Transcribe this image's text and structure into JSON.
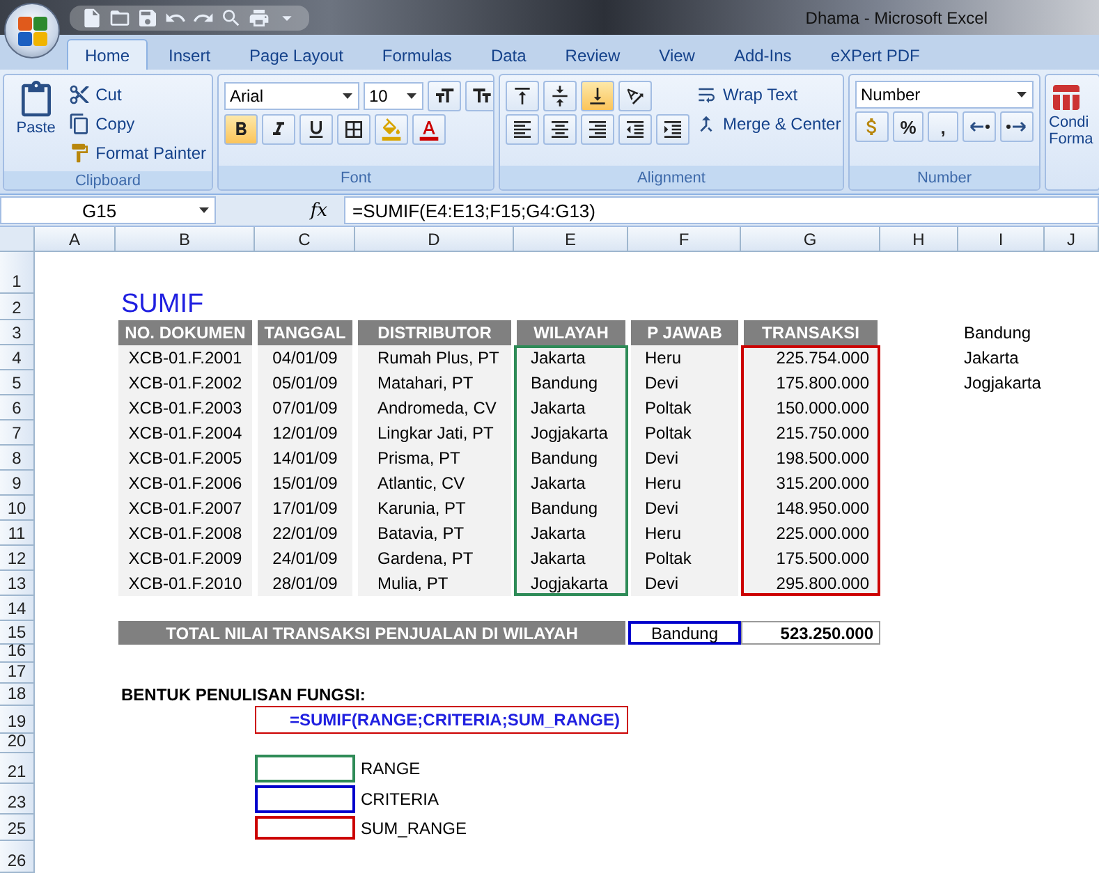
{
  "window": {
    "title": "Dhama - Microsoft Excel"
  },
  "ribbon_tabs": [
    {
      "label": "Home",
      "selected": true
    },
    {
      "label": "Insert",
      "selected": false
    },
    {
      "label": "Page Layout",
      "selected": false
    },
    {
      "label": "Formulas",
      "selected": false
    },
    {
      "label": "Data",
      "selected": false
    },
    {
      "label": "Review",
      "selected": false
    },
    {
      "label": "View",
      "selected": false
    },
    {
      "label": "Add-Ins",
      "selected": false
    },
    {
      "label": "eXPert PDF",
      "selected": false
    }
  ],
  "clipboard": {
    "label": "Clipboard",
    "paste": "Paste",
    "cut": "Cut",
    "copy": "Copy",
    "format_painter": "Format Painter"
  },
  "font": {
    "label": "Font",
    "name": "Arial",
    "size": "10",
    "bold": true
  },
  "alignment": {
    "label": "Alignment",
    "bottom_align": true,
    "wrap_text": "Wrap Text",
    "merge_center": "Merge & Center"
  },
  "number": {
    "label": "Number",
    "format": "Number",
    "percent": "%",
    "comma": ","
  },
  "styles": {
    "label_line_1": "Condi",
    "label_line_2": "Forma"
  },
  "formula_bar": {
    "name_box": "G15",
    "fx": "fx",
    "formula": "=SUMIF(E4:E13;F15;G4:G13)"
  },
  "sheet": {
    "columns": [
      "A",
      "B",
      "C",
      "D",
      "E",
      "F",
      "G",
      "H",
      "I",
      "J"
    ],
    "row_numbers": [
      "1",
      "2",
      "3",
      "4",
      "5",
      "6",
      "7",
      "8",
      "9",
      "10",
      "11",
      "12",
      "13",
      "14",
      "15",
      "16",
      "17",
      "18",
      "19",
      "20",
      "21",
      "23",
      "25",
      "26"
    ],
    "title": "SUMIF",
    "table": {
      "columns": [
        "NO. DOKUMEN",
        "TANGGAL",
        "DISTRIBUTOR",
        "WILAYAH",
        "P JAWAB",
        "TRANSAKSI"
      ],
      "rows": [
        [
          "XCB-01.F.2001",
          "04/01/09",
          "Rumah Plus, PT",
          "Jakarta",
          "Heru",
          "225.754.000"
        ],
        [
          "XCB-01.F.2002",
          "05/01/09",
          "Matahari, PT",
          "Bandung",
          "Devi",
          "175.800.000"
        ],
        [
          "XCB-01.F.2003",
          "07/01/09",
          "Andromeda, CV",
          "Jakarta",
          "Poltak",
          "150.000.000"
        ],
        [
          "XCB-01.F.2004",
          "12/01/09",
          "Lingkar Jati, PT",
          "Jogjakarta",
          "Poltak",
          "215.750.000"
        ],
        [
          "XCB-01.F.2005",
          "14/01/09",
          "Prisma, PT",
          "Bandung",
          "Devi",
          "198.500.000"
        ],
        [
          "XCB-01.F.2006",
          "15/01/09",
          "Atlantic, CV",
          "Jakarta",
          "Heru",
          "315.200.000"
        ],
        [
          "XCB-01.F.2007",
          "17/01/09",
          "Karunia, PT",
          "Bandung",
          "Devi",
          "148.950.000"
        ],
        [
          "XCB-01.F.2008",
          "22/01/09",
          "Batavia, PT",
          "Jakarta",
          "Heru",
          "225.000.000"
        ],
        [
          "XCB-01.F.2009",
          "24/01/09",
          "Gardena, PT",
          "Jakarta",
          "Poltak",
          "175.500.000"
        ],
        [
          "XCB-01.F.2010",
          "28/01/09",
          "Mulia, PT",
          "Jogjakarta",
          "Devi",
          "295.800.000"
        ]
      ]
    },
    "regions": [
      "Bandung",
      "Jakarta",
      "Jogjakarta"
    ],
    "total": {
      "label": "TOTAL NILAI TRANSAKSI PENJUALAN DI WILAYAH",
      "criteria": "Bandung",
      "value": "523.250.000"
    },
    "syntax_heading": "BENTUK PENULISAN FUNGSI:",
    "syntax": "=SUMIF(RANGE;CRITERIA;SUM_RANGE)",
    "legend": [
      {
        "kind": "range",
        "label": "RANGE",
        "color": "#2e8b57"
      },
      {
        "kind": "criteria",
        "label": "CRITERIA",
        "color": "#0000cc"
      },
      {
        "kind": "sum_range",
        "label": "SUM_RANGE",
        "color": "#cc0000"
      }
    ]
  }
}
